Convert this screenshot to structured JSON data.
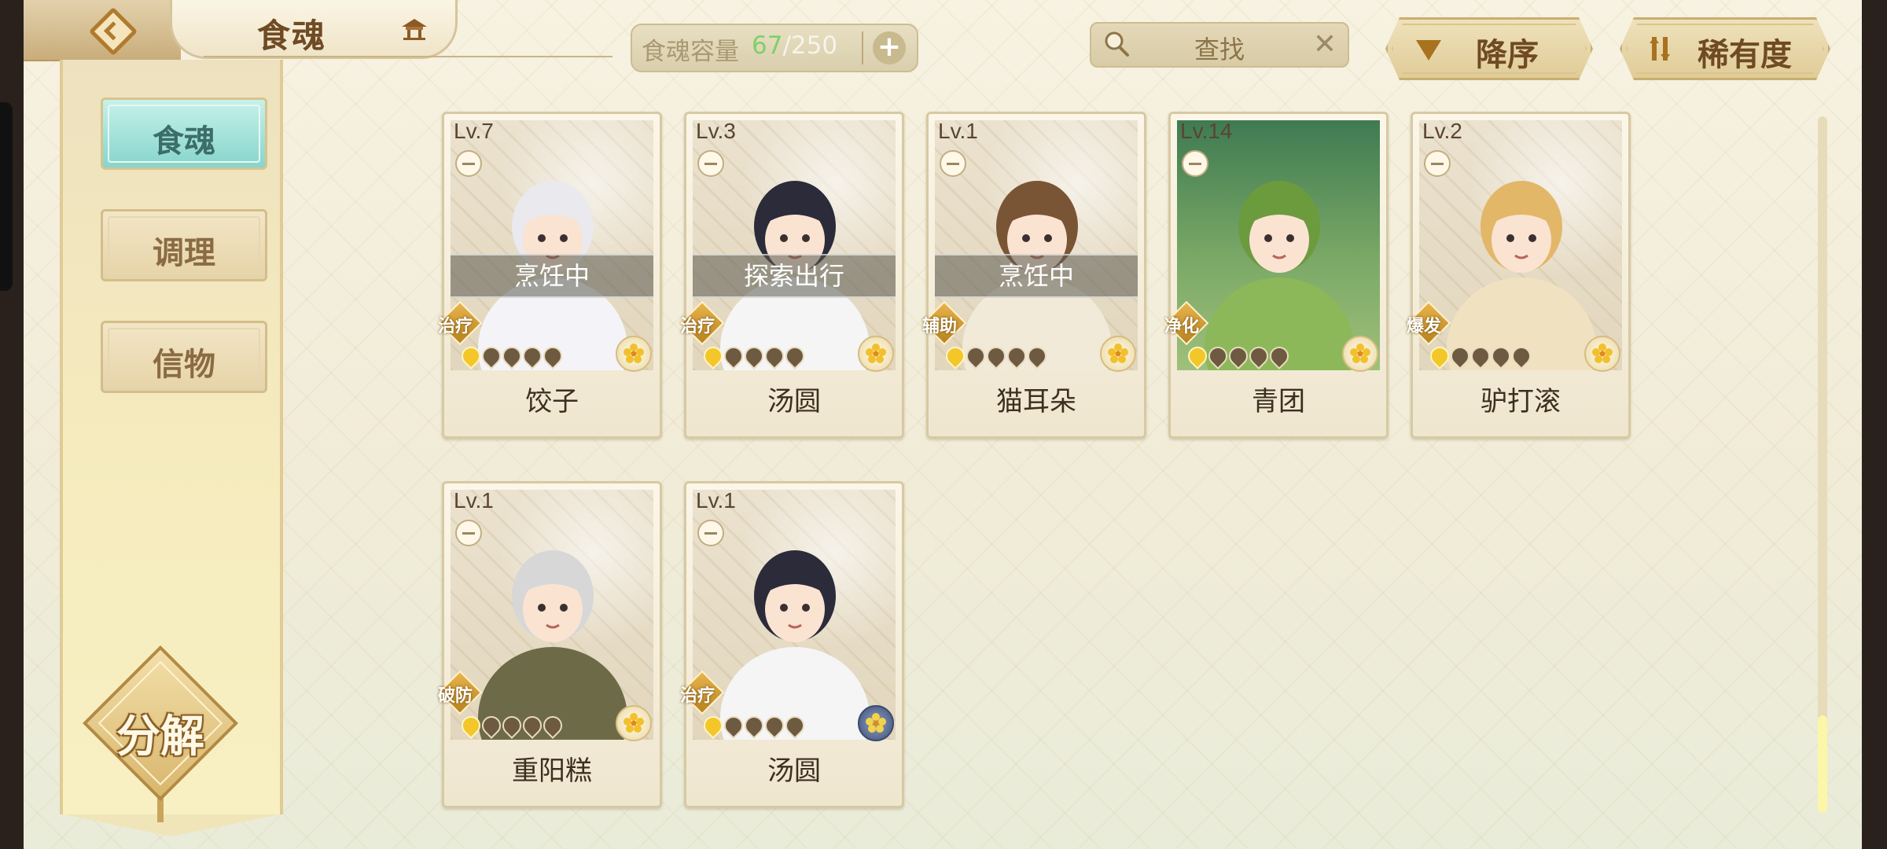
{
  "header": {
    "title": "食魂",
    "capacity_label": "食魂容量",
    "capacity_current": "67",
    "capacity_sep": "/",
    "capacity_max": "250",
    "search_placeholder": "查找",
    "sort_order_label": "降序",
    "sort_key_label": "稀有度"
  },
  "sidebar": {
    "tabs": [
      {
        "label": "食魂",
        "active": true
      },
      {
        "label": "调理",
        "active": false
      },
      {
        "label": "信物",
        "active": false
      }
    ],
    "decompose_label": "分解"
  },
  "cards": [
    {
      "level": "Lv.7",
      "status": "烹饪中",
      "role": "治疗",
      "name": "饺子",
      "stars_lit": 1,
      "rarity_color": "gold"
    },
    {
      "level": "Lv.3",
      "status": "探索出行",
      "role": "治疗",
      "name": "汤圆",
      "stars_lit": 1,
      "rarity_color": "gold"
    },
    {
      "level": "Lv.1",
      "status": "烹饪中",
      "role": "辅助",
      "name": "猫耳朵",
      "stars_lit": 1,
      "rarity_color": "gold"
    },
    {
      "level": "Lv.14",
      "status": "",
      "role": "净化",
      "name": "青团",
      "stars_lit": 1,
      "rarity_color": "gold"
    },
    {
      "level": "Lv.2",
      "status": "",
      "role": "爆发",
      "name": "驴打滚",
      "stars_lit": 1,
      "rarity_color": "gold"
    },
    {
      "level": "Lv.1",
      "status": "",
      "role": "破防",
      "name": "重阳糕",
      "stars_lit": 1,
      "rarity_color": "gold"
    },
    {
      "level": "Lv.1",
      "status": "",
      "role": "治疗",
      "name": "汤圆",
      "stars_lit": 1,
      "rarity_color": "blue"
    }
  ],
  "colors": {
    "capacity_current": "#7fcf6a",
    "active_tab": "#86d5cc",
    "brand_brown": "#6f4a23"
  },
  "icons": {
    "back": "back-arrow-icon",
    "home": "pavilion-icon",
    "search": "search-icon",
    "clear": "close-icon",
    "plus": "plus-icon",
    "sort_desc": "triangle-down-icon",
    "rarity_sort": "sort-bars-icon",
    "rarity": "flower-icon",
    "star": "flame-star-icon"
  }
}
